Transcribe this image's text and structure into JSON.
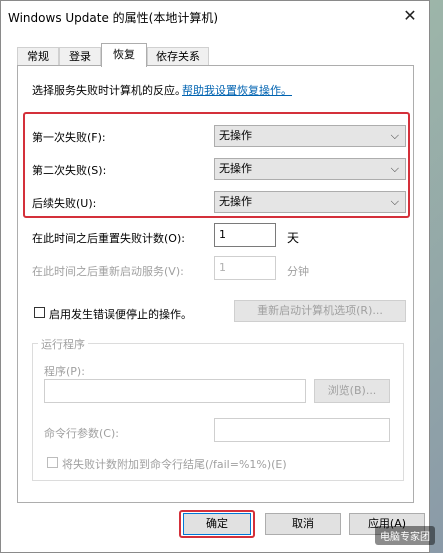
{
  "window": {
    "title": "Windows Update 的属性(本地计算机)",
    "close_glyph": "✕"
  },
  "tabs": [
    {
      "label": "常规"
    },
    {
      "label": "登录"
    },
    {
      "label": "恢复"
    },
    {
      "label": "依存关系"
    }
  ],
  "recovery": {
    "intro_text": "选择服务失败时计算机的反应。",
    "help_link": "帮助我设置恢复操作。",
    "first_failure_label": "第一次失败(F):",
    "first_failure_value": "无操作",
    "second_failure_label": "第二次失败(S):",
    "second_failure_value": "无操作",
    "subsequent_failure_label": "后续失败(U):",
    "subsequent_failure_value": "无操作",
    "reset_count_label": "在此时间之后重置失败计数(O):",
    "reset_count_value": "1",
    "reset_count_unit": "天",
    "restart_service_label": "在此时间之后重新启动服务(V):",
    "restart_service_value": "1",
    "restart_service_unit": "分钟",
    "enable_actions_label": "启用发生错误便停止的操作。",
    "restart_computer_options": "重新启动计算机选项(R)..."
  },
  "run_program": {
    "group_label": "运行程序",
    "program_label": "程序(P):",
    "program_value": "",
    "browse_button": "浏览(B)...",
    "cmd_params_label": "命令行参数(C):",
    "cmd_params_value": "",
    "append_fail_label": "将失败计数附加到命令行结尾(/fail=%1%)(E)"
  },
  "footer": {
    "ok": "确定",
    "cancel": "取消",
    "apply": "应用(A)"
  },
  "watermark": "电脑专家团",
  "colors": {
    "highlight": "#d4303a",
    "link": "#0063b1"
  },
  "icons": {
    "dropdown": "chevron-down-icon",
    "close": "close-icon"
  }
}
